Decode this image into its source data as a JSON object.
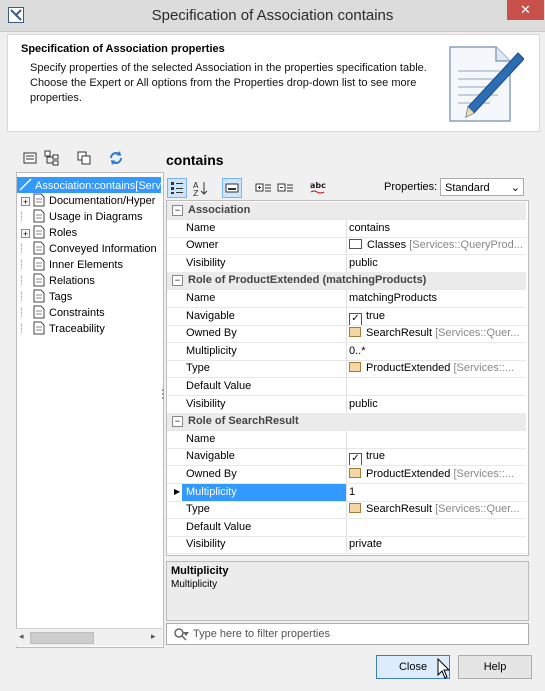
{
  "window": {
    "title": "Specification of Association contains",
    "close_glyph": "✕"
  },
  "header": {
    "title": "Specification of Association properties",
    "description": "Specify properties of the selected Association in the properties specification table. Choose the Expert or All options from the Properties drop-down list to see more properties."
  },
  "tree": {
    "items": [
      {
        "label": "Association:contains[Serv",
        "selected": true,
        "expander": "",
        "level": 0
      },
      {
        "label": "Documentation/Hyper",
        "expander": "+",
        "level": 1
      },
      {
        "label": "Usage in Diagrams",
        "expander": "",
        "level": 1
      },
      {
        "label": "Roles",
        "expander": "+",
        "level": 1
      },
      {
        "label": "Conveyed Information",
        "expander": "",
        "level": 1
      },
      {
        "label": "Inner Elements",
        "expander": "",
        "level": 1
      },
      {
        "label": "Relations",
        "expander": "",
        "level": 1
      },
      {
        "label": "Tags",
        "expander": "",
        "level": 1
      },
      {
        "label": "Constraints",
        "expander": "",
        "level": 1
      },
      {
        "label": "Traceability",
        "expander": "",
        "level": 1
      }
    ]
  },
  "element_title": "contains",
  "toolbar": {
    "properties_label": "Properties:",
    "properties_value": "Standard",
    "abc_label": "abc"
  },
  "grid": {
    "rows": [
      {
        "kind": "group",
        "label": "Association"
      },
      {
        "name": "Name",
        "value": "contains"
      },
      {
        "name": "Owner",
        "icon": "package",
        "value": "Classes",
        "extra": "[Services::QueryProd..."
      },
      {
        "name": "Visibility",
        "value": "public"
      },
      {
        "kind": "group",
        "label": "Role of ProductExtended (matchingProducts)"
      },
      {
        "name": "Name",
        "value": "matchingProducts"
      },
      {
        "name": "Navigable",
        "icon": "checkbox",
        "value": "true"
      },
      {
        "name": "Owned By",
        "icon": "class",
        "value": "SearchResult",
        "extra": "[Services::Quer..."
      },
      {
        "name": "Multiplicity",
        "value": "0..*"
      },
      {
        "name": "Type",
        "icon": "class",
        "value": "ProductExtended",
        "extra": "[Services::..."
      },
      {
        "name": "Default Value",
        "value": ""
      },
      {
        "name": "Visibility",
        "value": "public"
      },
      {
        "kind": "group",
        "label": "Role of SearchResult"
      },
      {
        "name": "Name",
        "value": ""
      },
      {
        "name": "Navigable",
        "icon": "checkbox",
        "value": "true"
      },
      {
        "name": "Owned By",
        "icon": "class",
        "value": "ProductExtended",
        "extra": "[Services::..."
      },
      {
        "name": "Multiplicity",
        "value": "1",
        "selected": true
      },
      {
        "name": "Type",
        "icon": "class",
        "value": "SearchResult",
        "extra": "[Services::Quer..."
      },
      {
        "name": "Default Value",
        "value": ""
      },
      {
        "name": "Visibility",
        "value": "private"
      }
    ]
  },
  "description_panel": {
    "title": "Multiplicity",
    "text": "Multiplicity"
  },
  "filter": {
    "placeholder": "Type here to filter properties"
  },
  "buttons": {
    "close": "Close",
    "help": "Help"
  }
}
